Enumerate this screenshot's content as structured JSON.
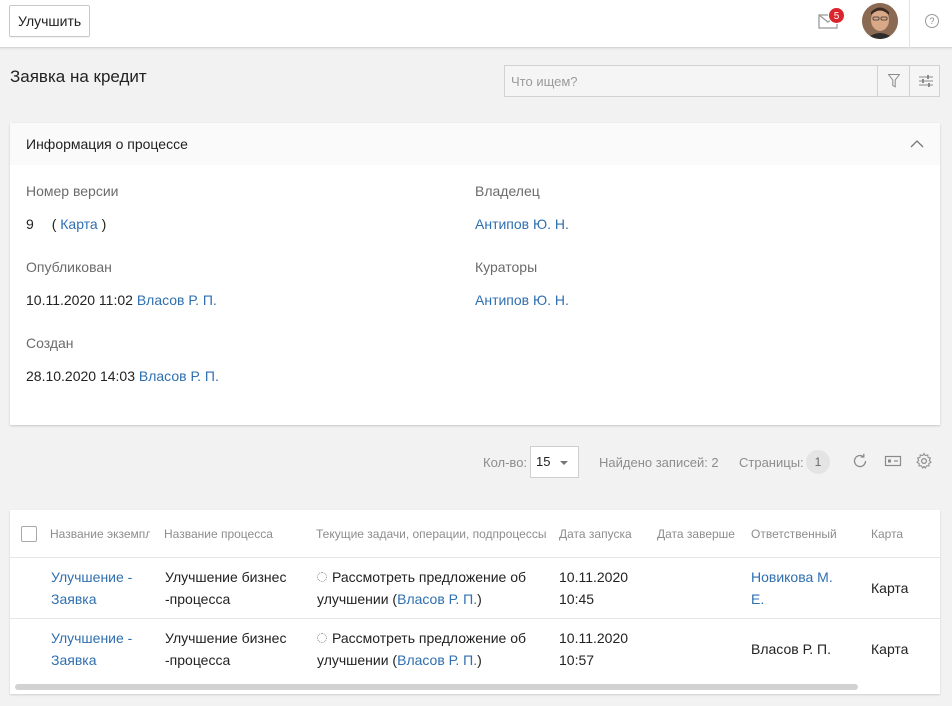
{
  "topbar": {
    "improve_label": "Улучшить",
    "mail_count": "5",
    "help_symbol": "?"
  },
  "page": {
    "title": "Заявка на кредит"
  },
  "search": {
    "placeholder": "Что ищем?"
  },
  "info": {
    "title": "Информация о процессе",
    "version_label": "Номер версии",
    "version_value": "9",
    "version_paren_open": "(",
    "version_link": "Карта",
    "version_paren_close": ")",
    "owner_label": "Владелец",
    "owner_value": "Антипов Ю. Н.",
    "published_label": "Опубликован",
    "published_date": "10.11.2020 11:02",
    "published_by": "Власов Р. П.",
    "curators_label": "Кураторы",
    "curators_value": "Антипов Ю. Н.",
    "created_label": "Создан",
    "created_date": "28.10.2020 14:03",
    "created_by": "Власов Р. П."
  },
  "pager": {
    "count_label": "Кол-во:",
    "count_value": "15",
    "found_label": "Найдено записей: 2",
    "pages_label": "Страницы:",
    "page_number": "1"
  },
  "table": {
    "columns": [
      "Название экземпляра",
      "Название процесса",
      "Текущие задачи, операции, подпроцессы",
      "Дата запуска",
      "Дата завершения",
      "Ответственный",
      "Карта"
    ],
    "rows": [
      {
        "instance_l1": "Улучшение -",
        "instance_l2": "Заявка",
        "process_l1": "Улучшение бизнес",
        "process_l2": "-процесса",
        "task_l1": "Рассмотреть предложение об",
        "task_l2_pre": "улучшении (",
        "task_l2_link": "Власов Р. П.",
        "task_l2_post": ")",
        "start_l1": "10.11.2020",
        "start_l2": "10:45",
        "resp_l1": "Новикова М.",
        "resp_l2": "Е.",
        "map": "Карта"
      },
      {
        "instance_l1": "Улучшение -",
        "instance_l2": "Заявка",
        "process_l1": "Улучшение бизнес",
        "process_l2": "-процесса",
        "task_l1": "Рассмотреть предложение об",
        "task_l2_pre": "улучшении (",
        "task_l2_link": "Власов Р. П.",
        "task_l2_post": ")",
        "start_l1": "10.11.2020",
        "start_l2": "10:57",
        "resp_l1": "Власов Р. П.",
        "map": "Карта"
      }
    ]
  },
  "colors": {
    "link": "#2f6fb0",
    "badge": "#d9252b",
    "background": "#f2f2f2"
  },
  "icons": [
    "mail-icon",
    "help-icon",
    "filter-icon",
    "settings-sliders-icon",
    "chevron-up-icon",
    "refresh-icon",
    "export-icon",
    "gear-icon",
    "task-pending-icon"
  ]
}
